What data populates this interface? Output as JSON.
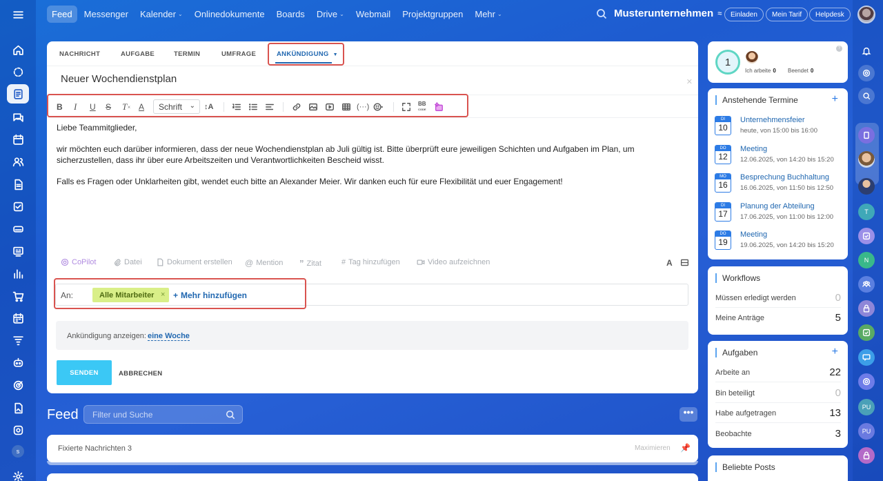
{
  "topnav": {
    "items": [
      {
        "label": "Feed",
        "active": true,
        "dropdown": false
      },
      {
        "label": "Messenger",
        "active": false,
        "dropdown": false
      },
      {
        "label": "Kalender",
        "active": false,
        "dropdown": true
      },
      {
        "label": "Onlinedokumente",
        "active": false,
        "dropdown": false
      },
      {
        "label": "Boards",
        "active": false,
        "dropdown": false
      },
      {
        "label": "Drive",
        "active": false,
        "dropdown": true
      },
      {
        "label": "Webmail",
        "active": false,
        "dropdown": false
      },
      {
        "label": "Projektgruppen",
        "active": false,
        "dropdown": false
      },
      {
        "label": "Mehr",
        "active": false,
        "dropdown": true
      }
    ],
    "company": "Musterunternehmen",
    "invite": "Einladen",
    "plan": "Mein Tarif",
    "help": "Helpdesk"
  },
  "composer": {
    "tabs": [
      "NACHRICHT",
      "AUFGABE",
      "TERMIN",
      "UMFRAGE",
      "ANKÜNDIGUNG"
    ],
    "active_tab": "ANKÜNDIGUNG",
    "title": "Neuer Wochendienstplan",
    "font_select": "Schrift",
    "body": [
      "Liebe Teammitglieder,",
      "wir möchten euch darüber informieren, dass der neue Wochendienstplan ab Juli gültig ist. Bitte überprüft eure jeweiligen Schichten und Aufgaben im Plan, um sicherzustellen, dass ihr über eure Arbeitszeiten und Verantwortlichkeiten Bescheid wisst.",
      "Falls es Fragen oder Unklarheiten gibt, wendet euch bitte an Alexander Meier. Wir danken euch für eure Flexibilität und euer Engagement!"
    ],
    "attachments": {
      "copilot": "CoPilot",
      "file": "Datei",
      "document": "Dokument erstellen",
      "mention": "Mention",
      "quote": "Zitat",
      "tag": "Tag hinzufügen",
      "video": "Video aufzeichnen",
      "format": "A"
    },
    "to_label": "An:",
    "recipient": "Alle Mitarbeiter",
    "add_more": "Mehr hinzufügen",
    "show_label": "Ankündigung anzeigen:",
    "show_value": "eine Woche",
    "send": "SENDEN",
    "cancel": "ABBRECHEN"
  },
  "feed": {
    "title": "Feed",
    "filter_placeholder": "Filter und Suche",
    "pinned_label": "Fixierte Nachrichten",
    "pinned_count": "3",
    "maximize": "Maximieren"
  },
  "worktime": {
    "counter": "1",
    "working_label": "Ich arbeite",
    "working_value": "0",
    "finished_label": "Beendet",
    "finished_value": "0"
  },
  "events": {
    "title": "Anstehende Termine",
    "items": [
      {
        "dow": "DI",
        "day": "10",
        "title": "Unternehmensfeier",
        "time": "heute, von 15:00 bis 16:00"
      },
      {
        "dow": "DO",
        "day": "12",
        "title": "Meeting",
        "time": "12.06.2025, von 14:20 bis 15:20"
      },
      {
        "dow": "MO",
        "day": "16",
        "title": "Besprechung Buchhaltung",
        "time": "16.06.2025, von 11:50 bis 12:50"
      },
      {
        "dow": "DI",
        "day": "17",
        "title": "Planung der Abteilung",
        "time": "17.06.2025, von 11:00 bis 12:00"
      },
      {
        "dow": "DO",
        "day": "19",
        "title": "Meeting",
        "time": "19.06.2025, von 14:20 bis 15:20"
      }
    ]
  },
  "workflows": {
    "title": "Workflows",
    "rows": [
      {
        "label": "Müssen erledigt werden",
        "value": "0",
        "muted": true
      },
      {
        "label": "Meine Anträge",
        "value": "5",
        "muted": false
      }
    ]
  },
  "tasks": {
    "title": "Aufgaben",
    "rows": [
      {
        "label": "Arbeite an",
        "value": "22",
        "muted": false
      },
      {
        "label": "Bin beteiligt",
        "value": "0",
        "muted": true
      },
      {
        "label": "Habe aufgetragen",
        "value": "13",
        "muted": false
      },
      {
        "label": "Beobachte",
        "value": "3",
        "muted": false
      }
    ]
  },
  "popular": {
    "title": "Beliebte Posts"
  },
  "leftrail": {
    "avatar_letter": "s"
  },
  "rightrail": {
    "t_letter": "T",
    "n_letter": "N",
    "pu_letter": "PU"
  }
}
